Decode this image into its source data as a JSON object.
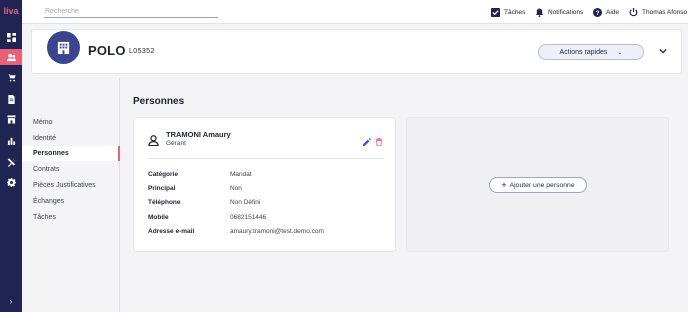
{
  "app": {
    "logo_text": "liva"
  },
  "search": {
    "placeholder": "Recherche",
    "value": ""
  },
  "topbar": {
    "tasks_label": "Tâches",
    "notifications_label": "Notifications",
    "help_label": "Aide",
    "user_name": "Thomas Afonso"
  },
  "rail": {
    "icons": [
      "dashboard-icon",
      "people-icon",
      "cart-icon",
      "document-icon",
      "store-icon",
      "chart-icon",
      "tools-icon",
      "settings-icon"
    ],
    "active": "people-icon",
    "expand_glyph": "›"
  },
  "entity": {
    "icon": "building-icon",
    "name": "POLO",
    "code": "L05352",
    "actions_label": "Actions rapides"
  },
  "nav": {
    "items": [
      {
        "label": "Mémo"
      },
      {
        "label": "Identité"
      },
      {
        "label": "Personnes"
      },
      {
        "label": "Contrats"
      },
      {
        "label": "Pièces Justificatives"
      },
      {
        "label": "Échanges"
      },
      {
        "label": "Tâches"
      }
    ],
    "active_index": 2
  },
  "main": {
    "title": "Personnes",
    "person": {
      "name": "TRAMONI Amaury",
      "role": "Gérant",
      "fields": [
        {
          "label": "Catégorie",
          "value": "Mandat"
        },
        {
          "label": "Principal",
          "value": "Non"
        },
        {
          "label": "Téléphone",
          "value": "Non Défini"
        },
        {
          "label": "Mobile",
          "value": "0682151446"
        },
        {
          "label": "Adresse e-mail",
          "value": "amaury.tramoni@test.demo.com"
        }
      ]
    },
    "add_person_label": "Ajouter une personne"
  },
  "colors": {
    "rail": "#1f2452",
    "accent": "#e8607a",
    "primary": "#3a4590",
    "edit": "#3a55c8"
  }
}
